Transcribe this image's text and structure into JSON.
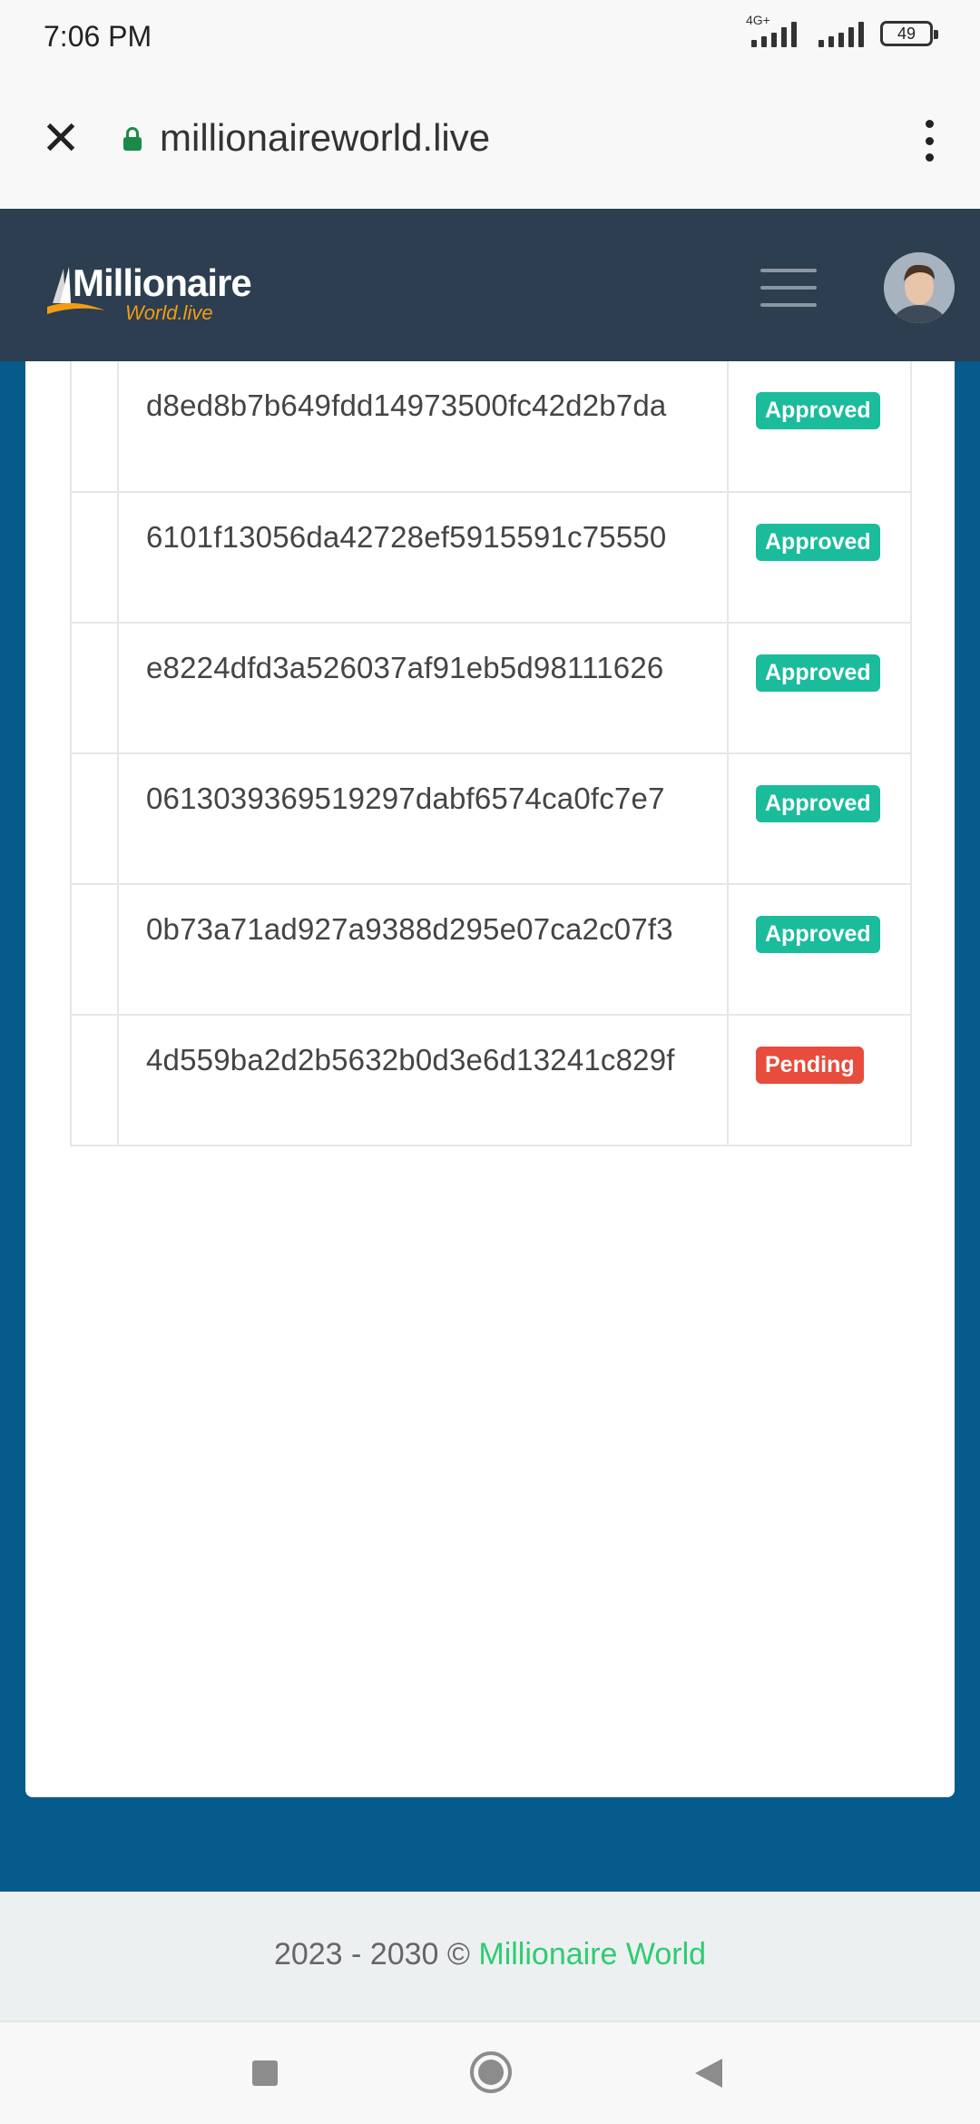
{
  "status_bar": {
    "time": "7:06 PM",
    "network": "4G+",
    "battery": "49"
  },
  "browser": {
    "url": "millionaireworld.live"
  },
  "header": {
    "logo_main": "Millionaire",
    "logo_sub": "World.live"
  },
  "transactions": [
    {
      "hash": "d8ed8b7b649fdd14973500fc42d2b7da",
      "status": "Approved"
    },
    {
      "hash": "6101f13056da42728ef5915591c75550",
      "status": "Approved"
    },
    {
      "hash": "e8224dfd3a526037af91eb5d98111626",
      "status": "Approved"
    },
    {
      "hash": "0613039369519297dabf6574ca0fc7e7",
      "status": "Approved"
    },
    {
      "hash": "0b73a71ad927a9388d295e07ca2c07f3",
      "status": "Approved"
    },
    {
      "hash": "4d559ba2d2b5632b0d3e6d13241c829f",
      "status": "Pending"
    }
  ],
  "footer": {
    "prefix": "2023 - 2030 © ",
    "brand": "Millionaire World"
  },
  "colors": {
    "header_bg": "#2c3e50",
    "main_bg": "#065b8c",
    "approved": "#1abc9c",
    "pending": "#e74c3c",
    "brand_green": "#2ecc71",
    "logo_orange": "#f39c12"
  }
}
